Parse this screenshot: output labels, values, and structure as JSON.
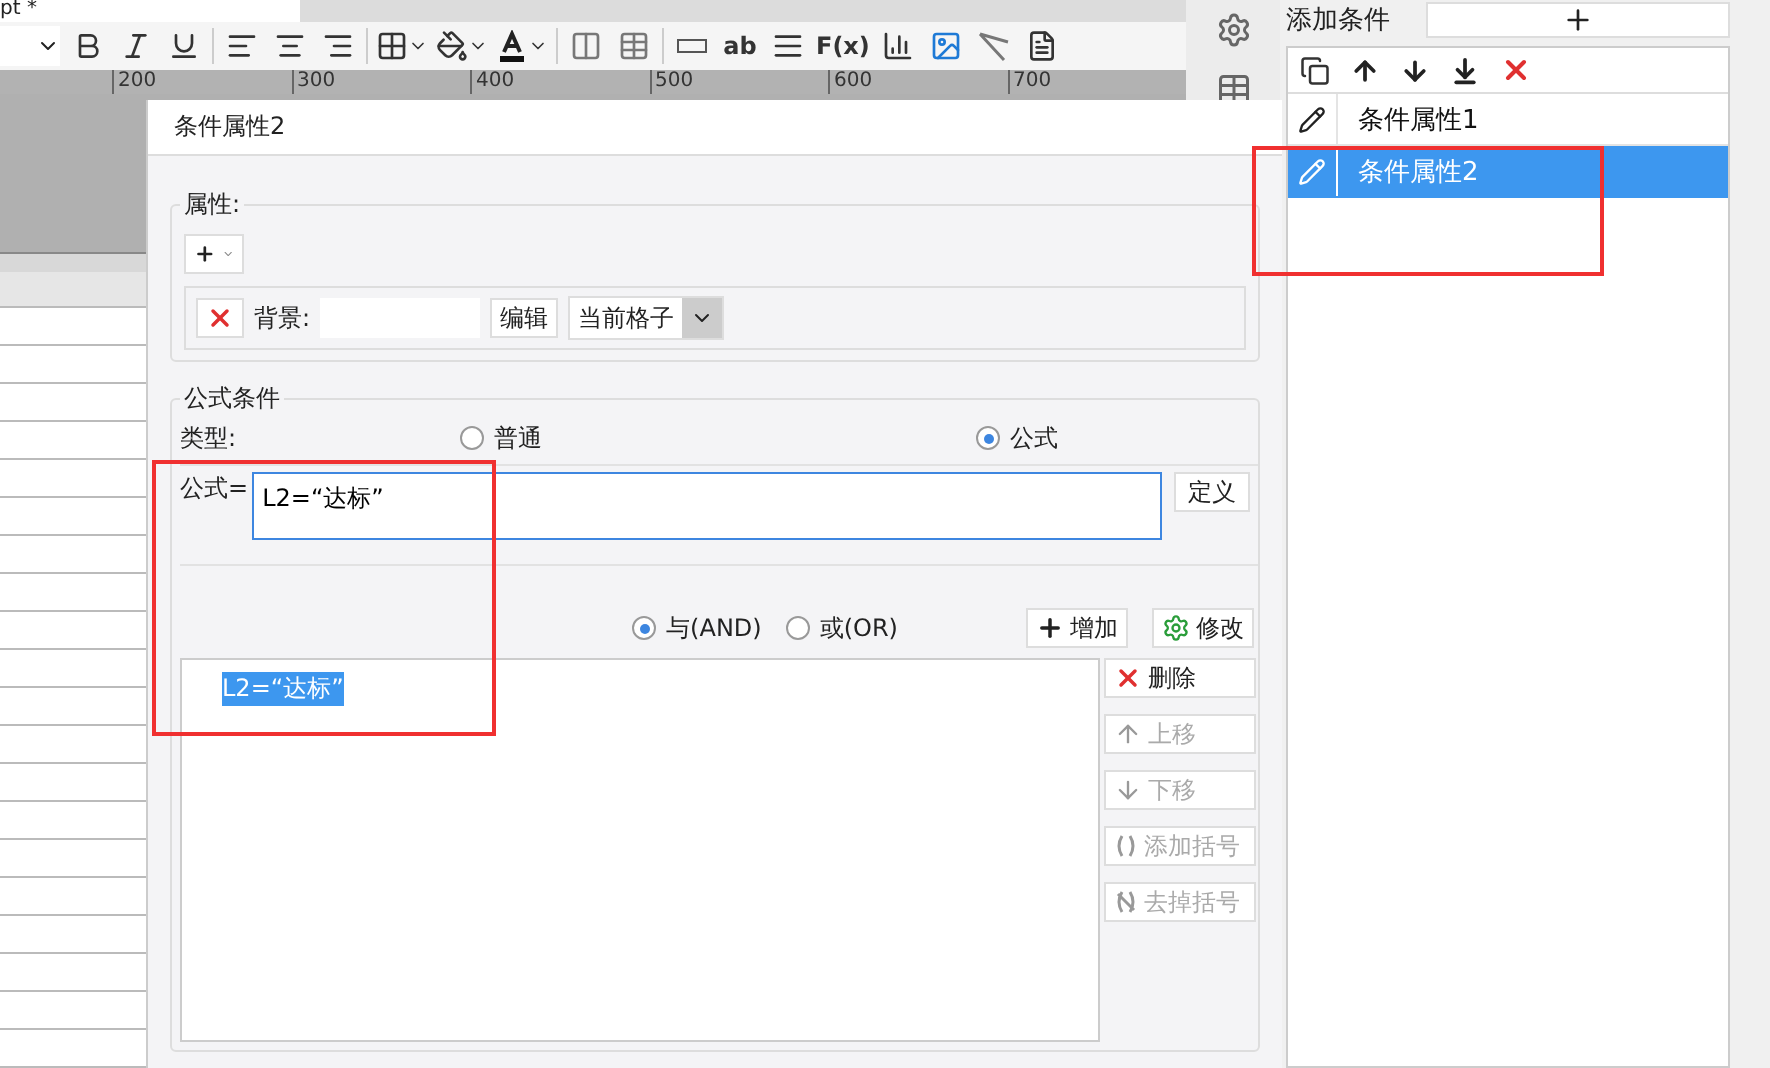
{
  "editor": {
    "tab_title": "pt *",
    "toolbar": [
      {
        "kind": "select"
      },
      {
        "kind": "bold"
      },
      {
        "kind": "italic"
      },
      {
        "kind": "underline"
      },
      {
        "kind": "sep"
      },
      {
        "kind": "align-left"
      },
      {
        "kind": "align-center"
      },
      {
        "kind": "align-right"
      },
      {
        "kind": "sep"
      },
      {
        "kind": "border"
      },
      {
        "kind": "fill"
      },
      {
        "kind": "font-color"
      },
      {
        "kind": "sep"
      },
      {
        "kind": "merge"
      },
      {
        "kind": "split"
      },
      {
        "kind": "sep"
      },
      {
        "kind": "field"
      },
      {
        "kind": "text",
        "label": "ab"
      },
      {
        "kind": "lines"
      },
      {
        "kind": "text",
        "label": "F(x)"
      },
      {
        "kind": "chart"
      },
      {
        "kind": "image"
      },
      {
        "kind": "slash"
      },
      {
        "kind": "report"
      }
    ],
    "ruler_marks": [
      "200",
      "300",
      "400",
      "500",
      "600",
      "700"
    ]
  },
  "dialog": {
    "title": "条件属性2",
    "property_group": {
      "legend": "属性:",
      "background_label": "背景:",
      "edit_button": "编辑",
      "scope": "当前格子"
    },
    "formula_group": {
      "legend": "公式条件",
      "type_label": "类型:",
      "types": [
        {
          "label": "普通",
          "selected": false
        },
        {
          "label": "公式",
          "selected": true
        }
      ],
      "formula_label": "公式=",
      "formula_value": "L2=“达标”",
      "define_button": "定义",
      "joins": [
        {
          "label": "与(AND)",
          "selected": true
        },
        {
          "label": "或(OR)",
          "selected": false
        }
      ],
      "add_button": "增加",
      "modify_button": "修改",
      "conditions": [
        {
          "label": "L2=“达标”",
          "selected": true
        }
      ],
      "actions": [
        {
          "kind": "delete",
          "label": "删除",
          "disabled": false
        },
        {
          "kind": "up",
          "label": "上移",
          "disabled": true
        },
        {
          "kind": "down",
          "label": "下移",
          "disabled": true
        },
        {
          "kind": "add-bracket",
          "label": "添加括号",
          "disabled": true
        },
        {
          "kind": "remove-bracket",
          "label": "去掉括号",
          "disabled": true
        }
      ]
    }
  },
  "conditions_panel": {
    "title": "添加条件",
    "items": [
      {
        "label": "条件属性1",
        "selected": false
      },
      {
        "label": "条件属性2",
        "selected": true
      }
    ]
  }
}
